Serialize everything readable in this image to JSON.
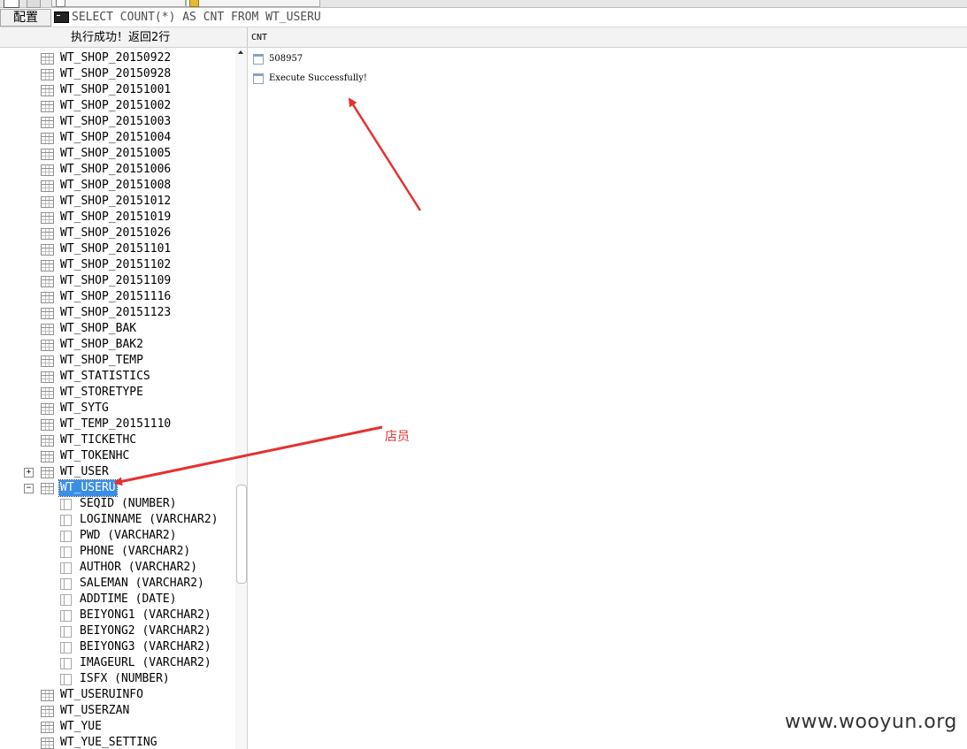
{
  "query_bar": {
    "config_label": "配置",
    "command_icon": "terminal-icon",
    "query_text": "SELECT COUNT(*) AS CNT FROM WT_USERU"
  },
  "status": {
    "message": "执行成功！返回2行",
    "column_header": "CNT"
  },
  "tree": {
    "tables_before": [
      "WT_SHOP_20150922",
      "WT_SHOP_20150928",
      "WT_SHOP_20151001",
      "WT_SHOP_20151002",
      "WT_SHOP_20151003",
      "WT_SHOP_20151004",
      "WT_SHOP_20151005",
      "WT_SHOP_20151006",
      "WT_SHOP_20151008",
      "WT_SHOP_20151012",
      "WT_SHOP_20151019",
      "WT_SHOP_20151026",
      "WT_SHOP_20151101",
      "WT_SHOP_20151102",
      "WT_SHOP_20151109",
      "WT_SHOP_20151116",
      "WT_SHOP_20151123",
      "WT_SHOP_BAK",
      "WT_SHOP_BAK2",
      "WT_SHOP_TEMP",
      "WT_STATISTICS",
      "WT_STORETYPE",
      "WT_SYTG",
      "WT_TEMP_20151110",
      "WT_TICKETHC",
      "WT_TOKENHC"
    ],
    "collapsed_table": {
      "label": "WT_USER",
      "expander": "+"
    },
    "expanded_table": {
      "label": "WT_USERU",
      "expander": "−",
      "columns": [
        "SEQID (NUMBER)",
        "LOGINNAME (VARCHAR2)",
        "PWD (VARCHAR2)",
        "PHONE (VARCHAR2)",
        "AUTHOR (VARCHAR2)",
        "SALEMAN (VARCHAR2)",
        "ADDTIME (DATE)",
        "BEIYONG1 (VARCHAR2)",
        "BEIYONG2 (VARCHAR2)",
        "BEIYONG3 (VARCHAR2)",
        "IMAGEURL (VARCHAR2)",
        "ISFX (NUMBER)"
      ]
    },
    "tables_after": [
      "WT_USERUINFO",
      "WT_USERZAN",
      "WT_YUE",
      "WT_YUE_SETTING"
    ]
  },
  "results": {
    "rows": [
      "508957",
      "Execute Successfully!"
    ]
  },
  "annotation": {
    "label": "店员",
    "color": "#e53030"
  },
  "watermark": "www.wooyun.org"
}
